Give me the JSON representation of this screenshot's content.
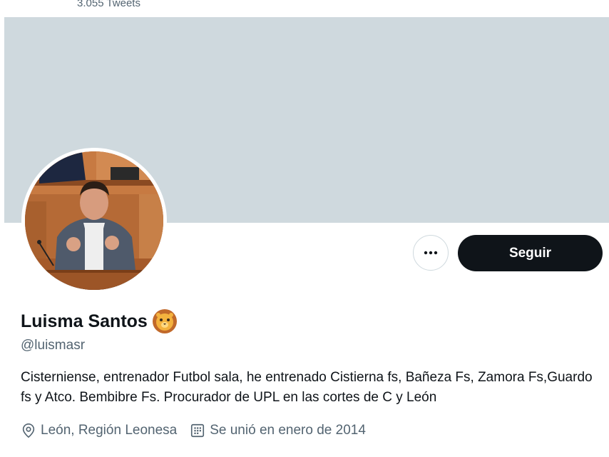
{
  "header": {
    "tweet_count": "3.055 Tweets"
  },
  "profile": {
    "display_name": "Luisma Santos",
    "name_emoji": "lion-face-emoji",
    "handle": "@luismasr",
    "bio": "Cisterniense, entrenador Futbol sala, he entrenado Cistierna fs, Bañeza Fs, Zamora Fs,Guardo fs y Atco. Bembibre Fs. Procurador de UPL en las cortes de C y León",
    "location": "León, Región Leonesa",
    "joined": "Se unió en enero de 2014"
  },
  "actions": {
    "follow_label": "Seguir",
    "more_icon": "more-horizontal-icon"
  },
  "colors": {
    "banner": "#cfd9de",
    "follow_button": "#0f1419",
    "secondary_text": "#536471"
  }
}
